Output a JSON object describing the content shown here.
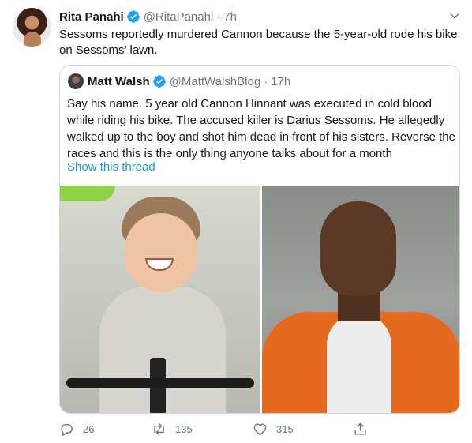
{
  "tweet": {
    "author_name": "Rita Panahi",
    "author_handle": "@RitaPanahi",
    "separator": "·",
    "time": "7h",
    "text": "Sessoms reportedly murdered Cannon because the 5-year-old rode his bike on Sessoms’ lawn."
  },
  "quoted": {
    "author_name": "Matt Walsh",
    "author_handle": "@MattWalshBlog",
    "separator": "·",
    "time": "17h",
    "text": "Say his name. 5 year old Cannon Hinnant was executed in cold blood while riding his bike. The accused killer is Darius Sessoms. He allegedly walked up to the boy and shot him dead in front of his sisters. Reverse the races and this is the only thing anyone talks about for a month",
    "show_thread": "Show this thread"
  },
  "actions": {
    "reply_count": "26",
    "retweet_count": "135",
    "like_count": "315"
  },
  "colors": {
    "link": "#1b95e0",
    "verified": "#1da1f2",
    "muted": "#657786",
    "border": "#ccd6dd"
  }
}
